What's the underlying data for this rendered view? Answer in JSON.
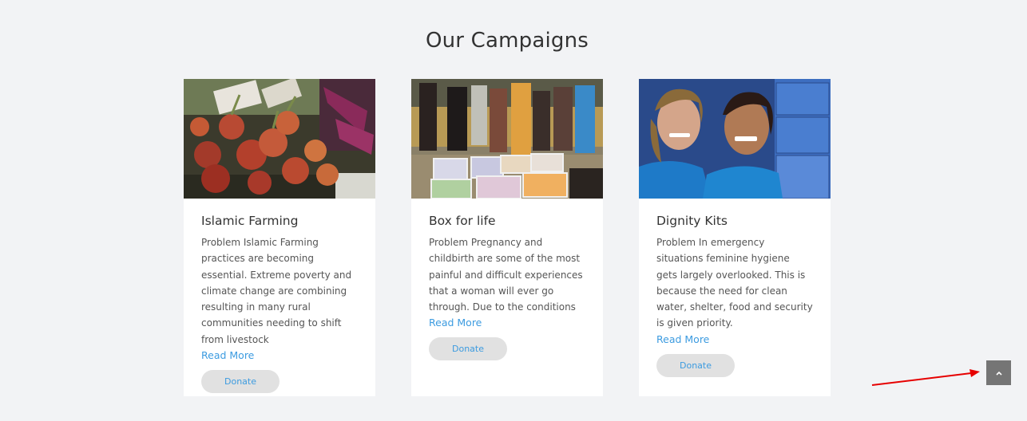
{
  "section": {
    "title": "Our Campaigns"
  },
  "campaigns": [
    {
      "title": "Islamic Farming",
      "description": "Problem Islamic Farming practices are becoming essential. Extreme poverty and climate change are combining resulting in many rural communities needing to shift from livestock",
      "read_more": "Read More",
      "donate": "Donate",
      "image": "beetroot-vegetables-photo"
    },
    {
      "title": "Box for life",
      "description": "Problem Pregnancy and childbirth are some of the most painful and difficult experiences that a woman will ever go through. Due to the conditions",
      "read_more": "Read More",
      "donate": "Donate",
      "image": "refugees-with-boxes-photo"
    },
    {
      "title": "Dignity Kits",
      "description": "Problem In emergency situations feminine hygiene gets largely overlooked. This is because the need for clean water, shelter, food and security is given priority.",
      "read_more": "Read More",
      "donate": "Donate",
      "image": "volunteers-dignity-kits-photo"
    }
  ],
  "scroll_top": {
    "icon": "chevron-up-icon"
  },
  "colors": {
    "background": "#f2f3f5",
    "link": "#3c9be0",
    "button_bg": "#e1e1e1",
    "scroll_btn": "#757575",
    "annotation": "#e60000"
  }
}
